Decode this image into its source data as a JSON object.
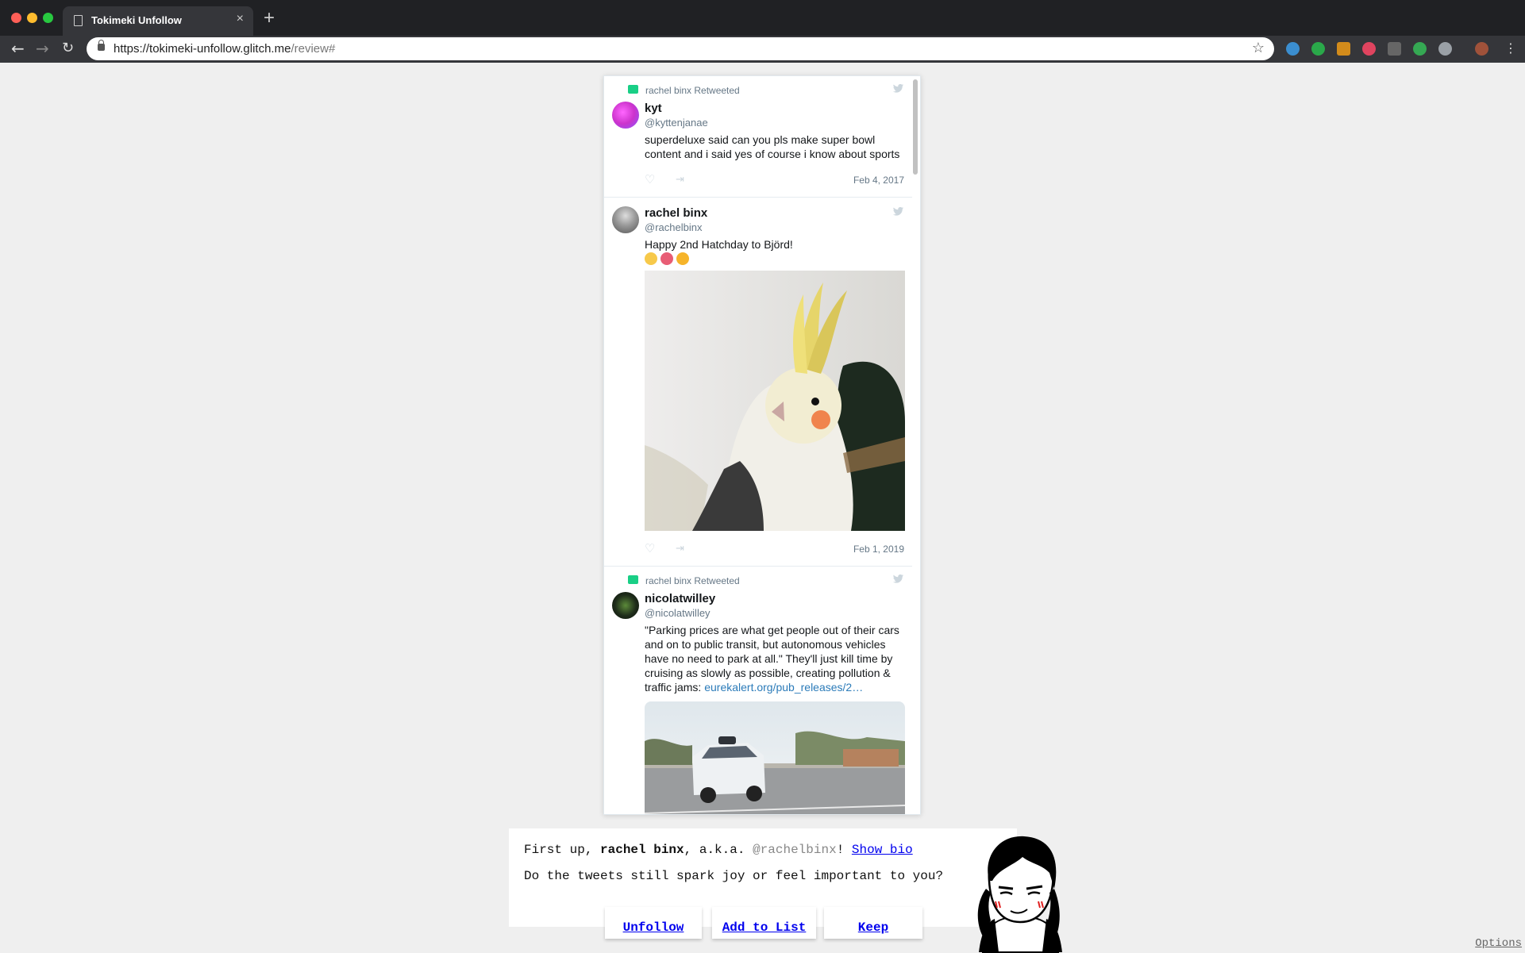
{
  "browser": {
    "tab_title": "Tokimeki Unfollow",
    "tab_close": "×",
    "new_tab": "+",
    "url_host": "https://tokimeki-unfollow.glitch.me",
    "url_path": "/review#"
  },
  "tweets": [
    {
      "retweeted_by": "rachel binx Retweeted",
      "name": "kyt",
      "handle": "@kyttenjanae",
      "text": "superdeluxe said can you pls make super bowl content and i said yes of course i know about sports",
      "date": "Feb 4, 2017"
    },
    {
      "name": "rachel binx",
      "handle": "@rachelbinx",
      "text": "Happy 2nd Hatchday to Björd!",
      "image_icon": "cockatiel-photo",
      "date": "Feb 1, 2019"
    },
    {
      "retweeted_by": "rachel binx Retweeted",
      "name": "nicolatwilley",
      "handle": "@nicolatwilley",
      "text": "\"Parking prices are what get people out of their cars and on to public  transit, but autonomous vehicles have no need to park at all.\" They'll just kill time by cruising as slowly as possible, creating pollution & traffic jams: ",
      "link": "eurekalert.org/pub_releases/2…",
      "image_icon": "self-driving-car-photo"
    }
  ],
  "review": {
    "intro_prefix": "First up, ",
    "name": "rachel binx",
    "aka": ", a.k.a. ",
    "handle": "@rachelbinx",
    "bang": "! ",
    "show_bio": "Show bio",
    "question": "Do the tweets still spark joy or feel important to you?"
  },
  "actions": {
    "unfollow": "Unfollow",
    "add_to_list": "Add to List",
    "keep": "Keep"
  },
  "options": "Options",
  "colors": {
    "retweet_green": "#19cf86",
    "link_blue": "#2b7bb9",
    "action_link": "#0000ee"
  }
}
